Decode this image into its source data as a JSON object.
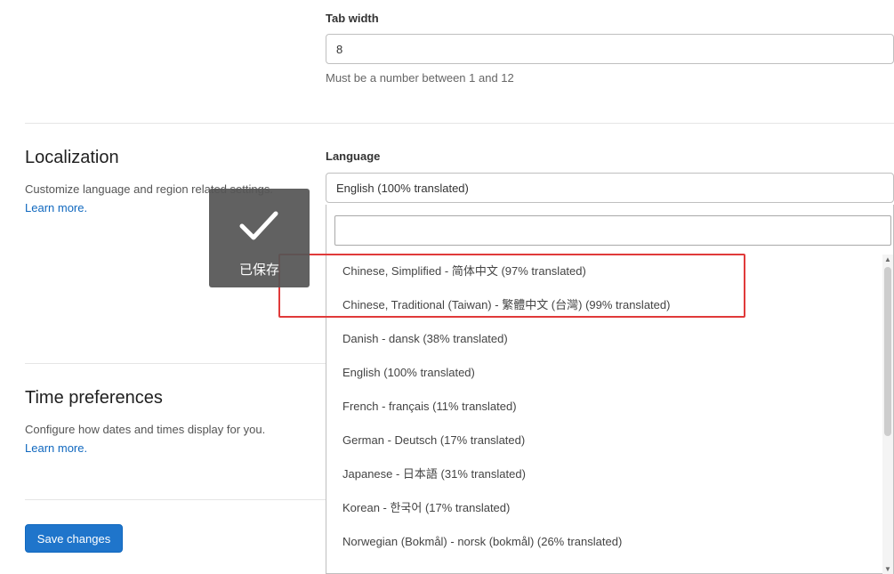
{
  "tab_width": {
    "label": "Tab width",
    "value": "8",
    "help": "Must be a number between 1 and 12"
  },
  "localization": {
    "title": "Localization",
    "description": "Customize language and region related settings.",
    "learn_more": "Learn more.",
    "language_label": "Language",
    "language_value": "English (100% translated)"
  },
  "language_dropdown": {
    "search_placeholder": "",
    "options": [
      "Chinese, Simplified - 简体中文 (97% translated)",
      "Chinese, Traditional (Taiwan) - 繁體中文 (台灣) (99% translated)",
      "Danish - dansk (38% translated)",
      "English (100% translated)",
      "French - français (11% translated)",
      "German - Deutsch (17% translated)",
      "Japanese - 日本語 (31% translated)",
      "Korean - 한국어 (17% translated)",
      "Norwegian (Bokmål) - norsk (bokmål) (26% translated)"
    ]
  },
  "time_preferences": {
    "title": "Time preferences",
    "description": "Configure how dates and times display for you.",
    "learn_more": "Learn more."
  },
  "toast": {
    "icon": "check-icon",
    "text": "已保存"
  },
  "actions": {
    "save_label": "Save changes"
  },
  "colors": {
    "primary": "#1f75cb",
    "highlight": "#e03a3a",
    "toast_bg": "#555555"
  }
}
